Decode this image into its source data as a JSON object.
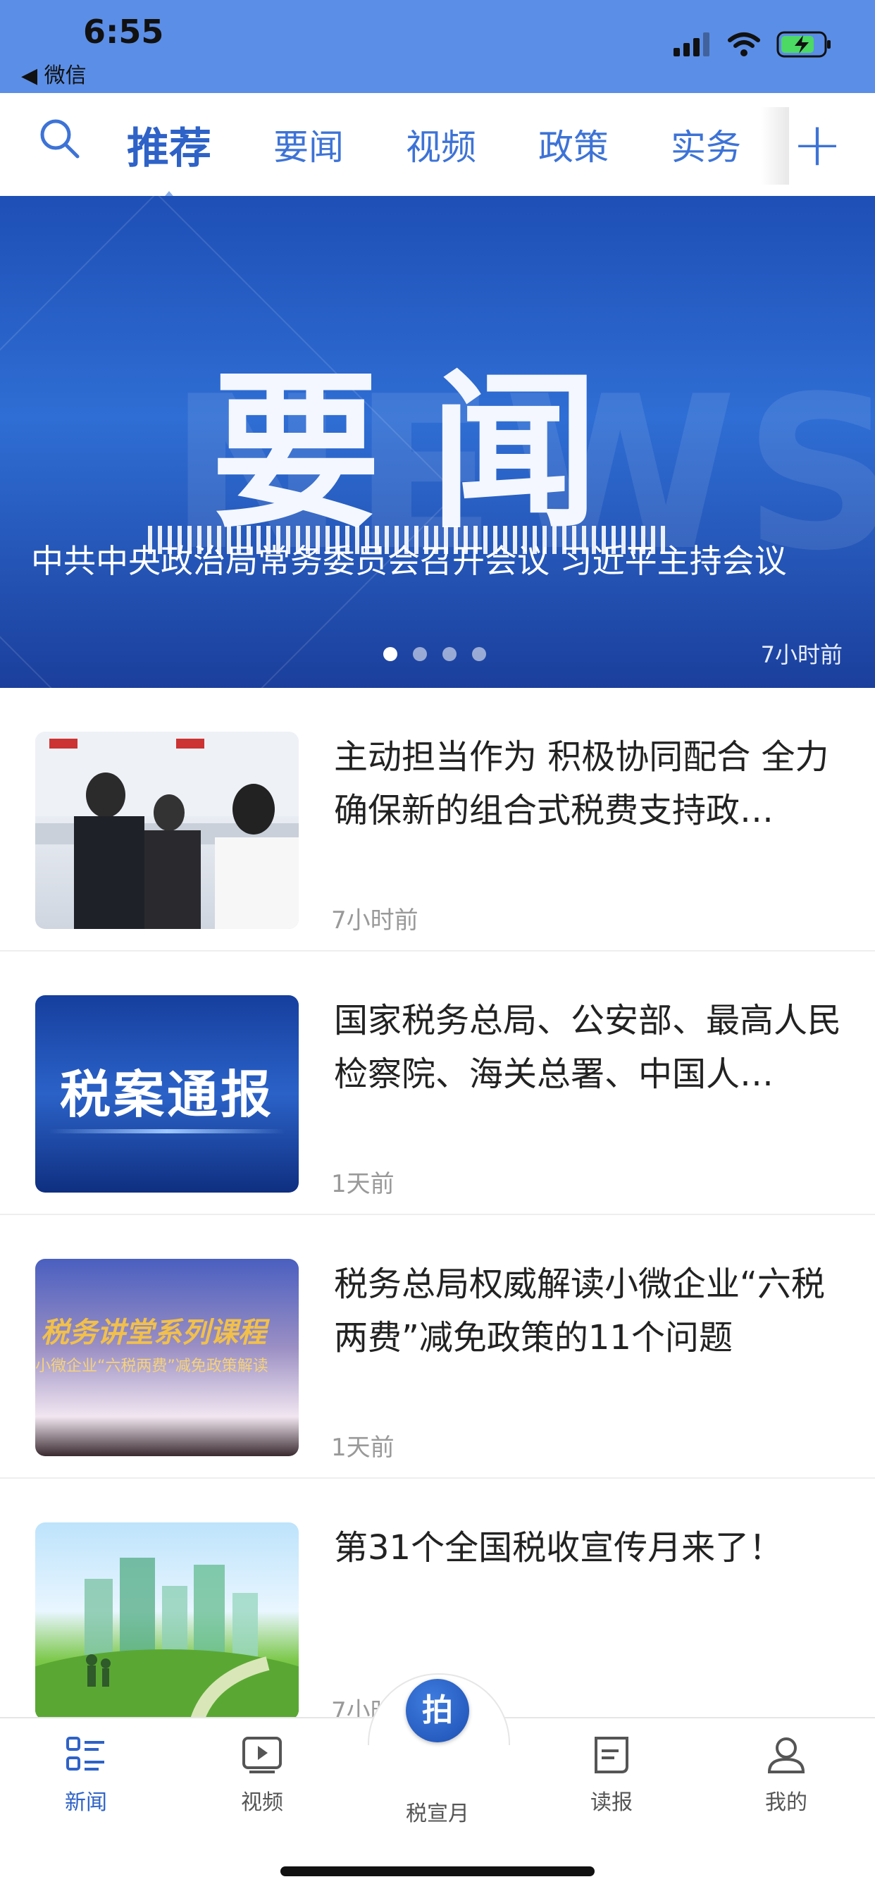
{
  "status_bar": {
    "time": "6:55",
    "back_app": "◀ 微信"
  },
  "top_nav": {
    "tabs": [
      {
        "label": "推荐",
        "active": true
      },
      {
        "label": "要闻"
      },
      {
        "label": "视频"
      },
      {
        "label": "政策"
      },
      {
        "label": "实务"
      }
    ],
    "plus_label": "+"
  },
  "banner": {
    "image_text": "要闻",
    "watermark": "NEWS",
    "headline": "中共中央政治局常务委员会召开会议 习近平主持会议",
    "time": "7小时前",
    "page_count": 4,
    "current_page": 1
  },
  "news": [
    {
      "title": "主动担当作为 积极协同配合 全力确保新的组合式税费支持政…",
      "time": "7小时前",
      "thumb": "photo-officials"
    },
    {
      "title": "国家税务总局、公安部、最高人民检察院、海关总署、中国人…",
      "time": "1天前",
      "thumb_text": "税案通报"
    },
    {
      "title": "税务总局权威解读小微企业“六税两费”减免政策的11个问题",
      "time": "1天前",
      "thumb_text": "税务讲堂系列课程",
      "thumb_sub": "小微企业“六税两费”减免政策解读"
    },
    {
      "title": "第31个全国税收宣传月来了！",
      "time": "7小时前",
      "thumb": "city-illustration"
    }
  ],
  "bottom_tabs": {
    "news": "新闻",
    "video": "视频",
    "center": "税宣月",
    "center_icon_text": "拍",
    "read": "读报",
    "mine": "我的"
  },
  "colors": {
    "primary": "#2e62c7",
    "status_bar": "#5b8ee6"
  }
}
